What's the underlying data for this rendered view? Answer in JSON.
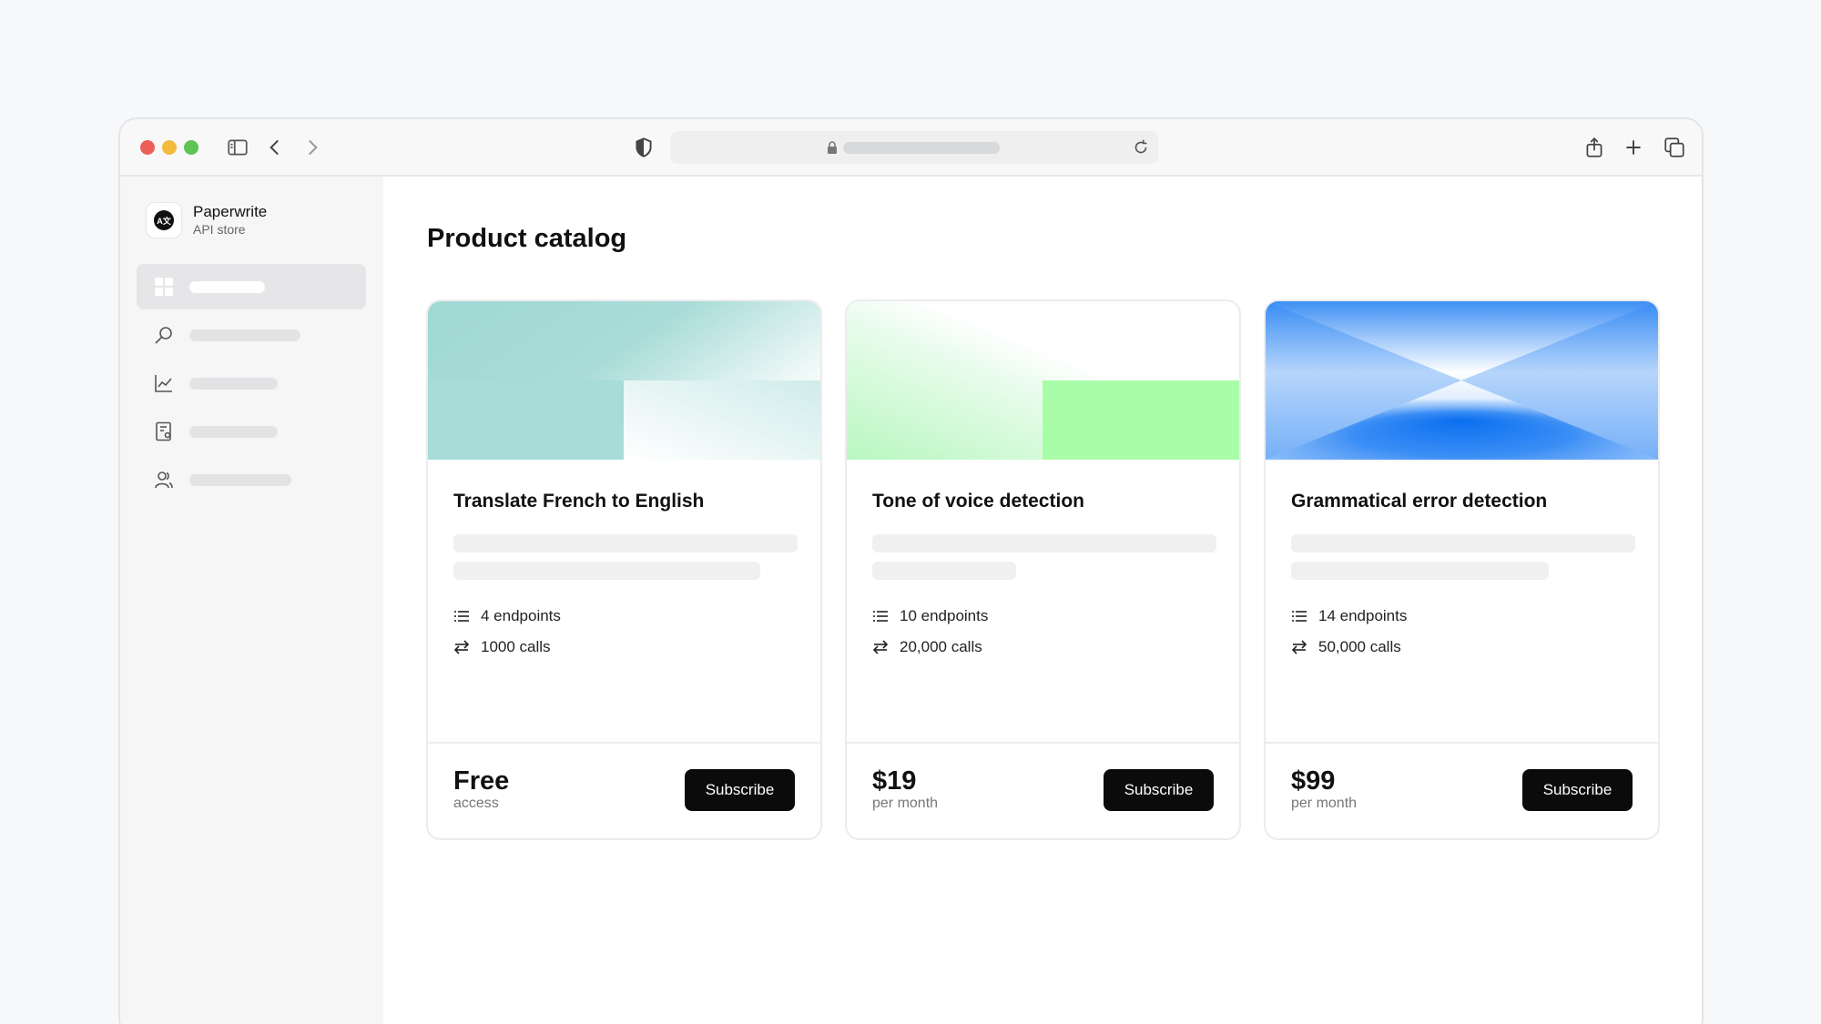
{
  "sidebar": {
    "brand": {
      "name": "Paperwrite",
      "subtitle": "API store",
      "logo_text": "A文"
    },
    "items": [
      {
        "icon": "dashboard-icon",
        "active": true
      },
      {
        "icon": "search-icon",
        "active": false
      },
      {
        "icon": "chart-icon",
        "active": false
      },
      {
        "icon": "document-icon",
        "active": false
      },
      {
        "icon": "users-icon",
        "active": false
      }
    ]
  },
  "main": {
    "title": "Product catalog",
    "cards": [
      {
        "title": "Translate French to English",
        "endpoints": "4 endpoints",
        "calls": "1000 calls",
        "price": "Free",
        "price_sub": "access",
        "button": "Subscribe"
      },
      {
        "title": "Tone of voice detection",
        "endpoints": "10 endpoints",
        "calls": "20,000 calls",
        "price": "$19",
        "price_sub": "per month",
        "button": "Subscribe"
      },
      {
        "title": "Grammatical error detection",
        "endpoints": "14 endpoints",
        "calls": "50,000 calls",
        "price": "$99",
        "price_sub": "per month",
        "button": "Subscribe"
      }
    ]
  },
  "colors": {
    "accent_teal": "#a7dcd8",
    "accent_green": "#a9fda9",
    "accent_blue": "#0a72f0",
    "button_bg": "#0b0b0b"
  }
}
